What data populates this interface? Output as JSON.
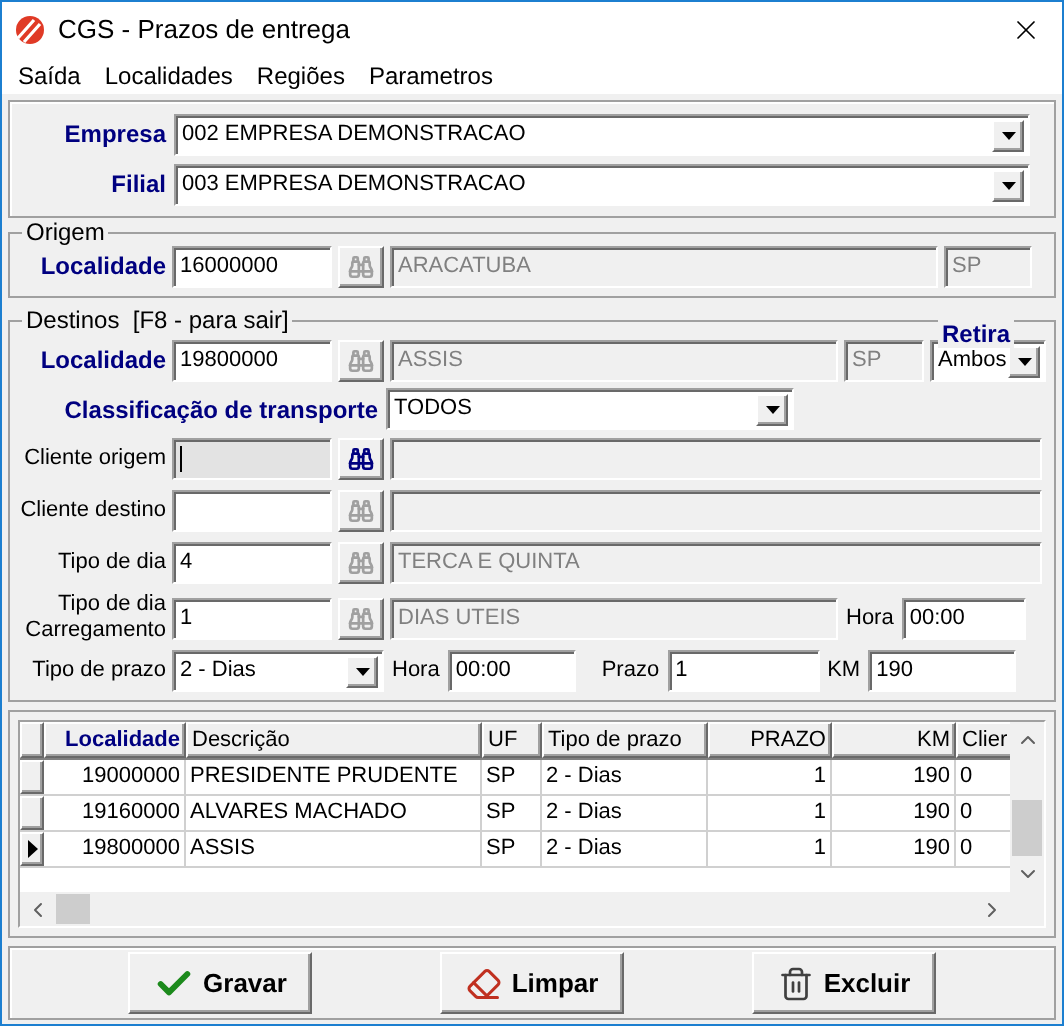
{
  "window": {
    "title": "CGS - Prazos de entrega"
  },
  "menu": [
    "Saída",
    "Localidades",
    "Regiões",
    "Parametros"
  ],
  "empresa": {
    "label": "Empresa",
    "value": "002 EMPRESA DEMONSTRACAO"
  },
  "filial": {
    "label": "Filial",
    "value": "003 EMPRESA DEMONSTRACAO"
  },
  "origem": {
    "title": "Origem",
    "label": "Localidade",
    "code": "16000000",
    "name": "ARACATUBA",
    "uf": "SP"
  },
  "destinos": {
    "title": "Destinos  [F8 - para sair]",
    "label": "Localidade",
    "code": "19800000",
    "name": "ASSIS",
    "uf": "SP",
    "retira": {
      "label": "Retira",
      "value": "Ambos"
    },
    "classificacao": {
      "label": "Classificação de transporte",
      "value": "TODOS"
    },
    "lookups": [
      {
        "label": "Cliente origem",
        "focused": true
      },
      {
        "label": "Cliente destino",
        "focused": false
      },
      {
        "label": "Tipo de dia",
        "code": "4",
        "name": "TERCA E QUINTA",
        "focused": false
      },
      {
        "label": "Tipo de dia Carregamento",
        "code": "1",
        "name": "DIAS UTEIS",
        "focused": false,
        "hora_label": "Hora",
        "hora": "00:00"
      }
    ],
    "tipo_prazo": {
      "label": "Tipo de prazo",
      "value": "2 - Dias"
    },
    "hora": {
      "label": "Hora",
      "value": "00:00"
    },
    "prazo": {
      "label": "Prazo",
      "value": "1"
    },
    "km": {
      "label": "KM",
      "value": "190"
    }
  },
  "table": {
    "columns": [
      {
        "label": "Localidade",
        "sorted": true,
        "kind": "number"
      },
      {
        "label": "Descrição",
        "sorted": false,
        "kind": "text"
      },
      {
        "label": "UF",
        "sorted": false,
        "kind": "text"
      },
      {
        "label": "Tipo de prazo",
        "sorted": false,
        "kind": "text"
      },
      {
        "label": "PRAZO",
        "sorted": false,
        "kind": "number"
      },
      {
        "label": "KM",
        "sorted": false,
        "kind": "number"
      },
      {
        "label": "Clier",
        "sorted": false,
        "kind": "text"
      }
    ],
    "rows": [
      {
        "cells": [
          "19000000",
          "PRESIDENTE PRUDENTE",
          "SP",
          "2 - Dias",
          "1",
          "190",
          "0"
        ],
        "selected": false
      },
      {
        "cells": [
          "19160000",
          "ALVARES MACHADO",
          "SP",
          "2 - Dias",
          "1",
          "190",
          "0"
        ],
        "selected": false
      },
      {
        "cells": [
          "19800000",
          "ASSIS",
          "SP",
          "2 - Dias",
          "1",
          "190",
          "0"
        ],
        "selected": true
      }
    ]
  },
  "buttons": [
    {
      "label": "Gravar",
      "kind": "save"
    },
    {
      "label": "Limpar",
      "kind": "clear"
    },
    {
      "label": "Excluir",
      "kind": "delete"
    }
  ]
}
